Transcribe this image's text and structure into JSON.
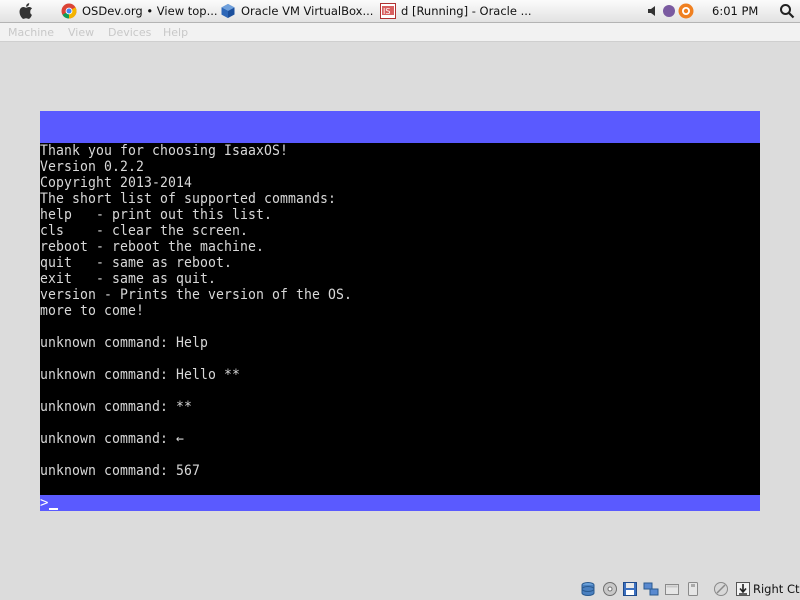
{
  "taskbar": {
    "tasks": [
      {
        "label": "OSDev.org • View top..."
      },
      {
        "label": "Oracle VM VirtualBox..."
      },
      {
        "label": "d [Running] - Oracle ..."
      }
    ],
    "clock": "6:01 PM"
  },
  "menubar": {
    "items": [
      "Machine",
      "View",
      "Devices",
      "Help"
    ]
  },
  "console": {
    "lines": [
      "Thank you for choosing IsaaxOS!",
      "Version 0.2.2",
      "Copyright 2013-2014",
      "The short list of supported commands:",
      "help   - print out this list.",
      "cls    - clear the screen.",
      "reboot - reboot the machine.",
      "quit   - same as reboot.",
      "exit   - same as quit.",
      "version - Prints the version of the OS.",
      "more to come!",
      "",
      "unknown command: Help",
      "",
      "unknown command: Hello **",
      "",
      "unknown command: **",
      "",
      "unknown command: ←",
      "",
      "unknown command: 567"
    ],
    "prompt": ">"
  },
  "statusbar": {
    "icons": [
      "hard-disk-icon",
      "optical-drive-icon",
      "floppy-icon",
      "network-icon",
      "shared-folders-icon",
      "usb-icon",
      "virtualization-icon",
      "mouse-integration-icon"
    ],
    "host_key": "Right Ctrl"
  },
  "colors": {
    "vm_bar": "#5a5aff",
    "console_bg": "#000000",
    "console_text": "#d8d8d8"
  }
}
